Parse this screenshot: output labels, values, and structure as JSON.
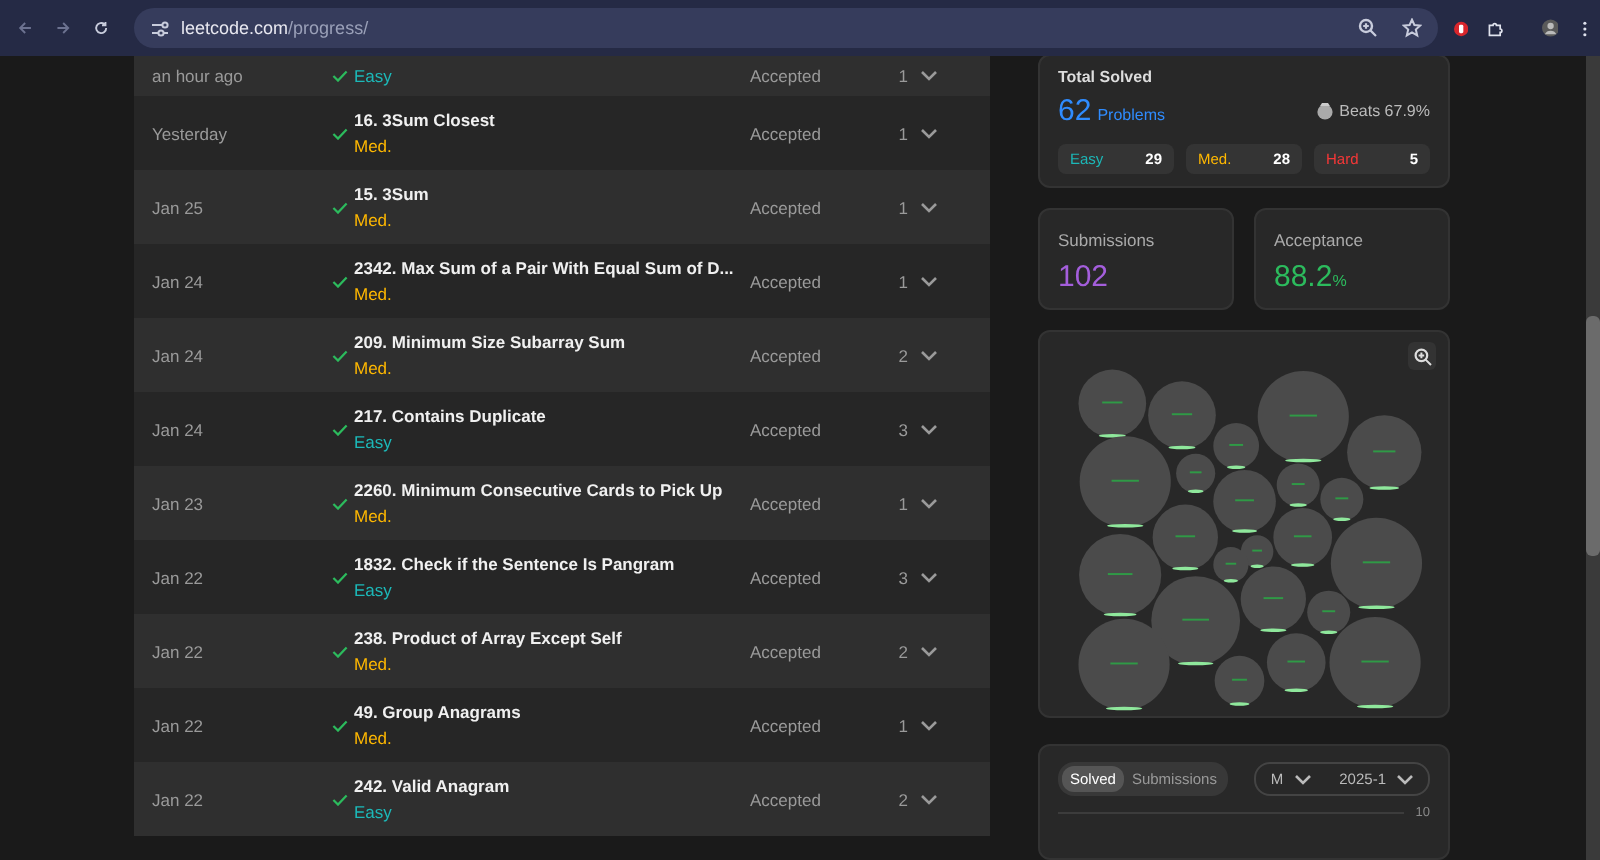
{
  "browser": {
    "url_host": "leetcode.com",
    "url_path": "/progress/"
  },
  "submissions": [
    {
      "time": "an hour ago",
      "kind": "easy",
      "difficulty_label": "Easy",
      "status": "Accepted",
      "attempts": "1",
      "partial": true
    },
    {
      "time": "Yesterday",
      "title": "16. 3Sum Closest",
      "kind": "medium",
      "difficulty_label": "Med.",
      "status": "Accepted",
      "attempts": "1"
    },
    {
      "time": "Jan 25",
      "title": "15. 3Sum",
      "kind": "medium",
      "difficulty_label": "Med.",
      "status": "Accepted",
      "attempts": "1"
    },
    {
      "time": "Jan 24",
      "title": "2342. Max Sum of a Pair With Equal Sum of D...",
      "kind": "medium",
      "difficulty_label": "Med.",
      "status": "Accepted",
      "attempts": "1"
    },
    {
      "time": "Jan 24",
      "title": "209. Minimum Size Subarray Sum",
      "kind": "medium",
      "difficulty_label": "Med.",
      "status": "Accepted",
      "attempts": "2"
    },
    {
      "time": "Jan 24",
      "title": "217. Contains Duplicate",
      "kind": "easy",
      "difficulty_label": "Easy",
      "status": "Accepted",
      "attempts": "3"
    },
    {
      "time": "Jan 23",
      "title": "2260. Minimum Consecutive Cards to Pick Up",
      "kind": "medium",
      "difficulty_label": "Med.",
      "status": "Accepted",
      "attempts": "1"
    },
    {
      "time": "Jan 22",
      "title": "1832. Check if the Sentence Is Pangram",
      "kind": "easy",
      "difficulty_label": "Easy",
      "status": "Accepted",
      "attempts": "3"
    },
    {
      "time": "Jan 22",
      "title": "238. Product of Array Except Self",
      "kind": "medium",
      "difficulty_label": "Med.",
      "status": "Accepted",
      "attempts": "2"
    },
    {
      "time": "Jan 22",
      "title": "49. Group Anagrams",
      "kind": "medium",
      "difficulty_label": "Med.",
      "status": "Accepted",
      "attempts": "1"
    },
    {
      "time": "Jan 22",
      "title": "242. Valid Anagram",
      "kind": "easy",
      "difficulty_label": "Easy",
      "status": "Accepted",
      "attempts": "2"
    }
  ],
  "total_solved": {
    "label": "Total Solved",
    "count": "62",
    "unit": "Problems",
    "beats": "Beats 67.9%",
    "breakdown": [
      {
        "label": "Easy",
        "count": "29",
        "kind": "easy"
      },
      {
        "label": "Med.",
        "count": "28",
        "kind": "medium"
      },
      {
        "label": "Hard",
        "count": "5",
        "kind": "hard"
      }
    ]
  },
  "submissions_card": {
    "label": "Submissions",
    "value": "102"
  },
  "acceptance_card": {
    "label": "Acceptance",
    "value": "88.2",
    "unit": "%"
  },
  "activity": {
    "toggle": [
      {
        "label": "Solved",
        "selected": true
      },
      {
        "label": "Submissions",
        "selected": false
      }
    ],
    "selects": [
      "M",
      "2025-1"
    ],
    "axis_tick": "10"
  }
}
